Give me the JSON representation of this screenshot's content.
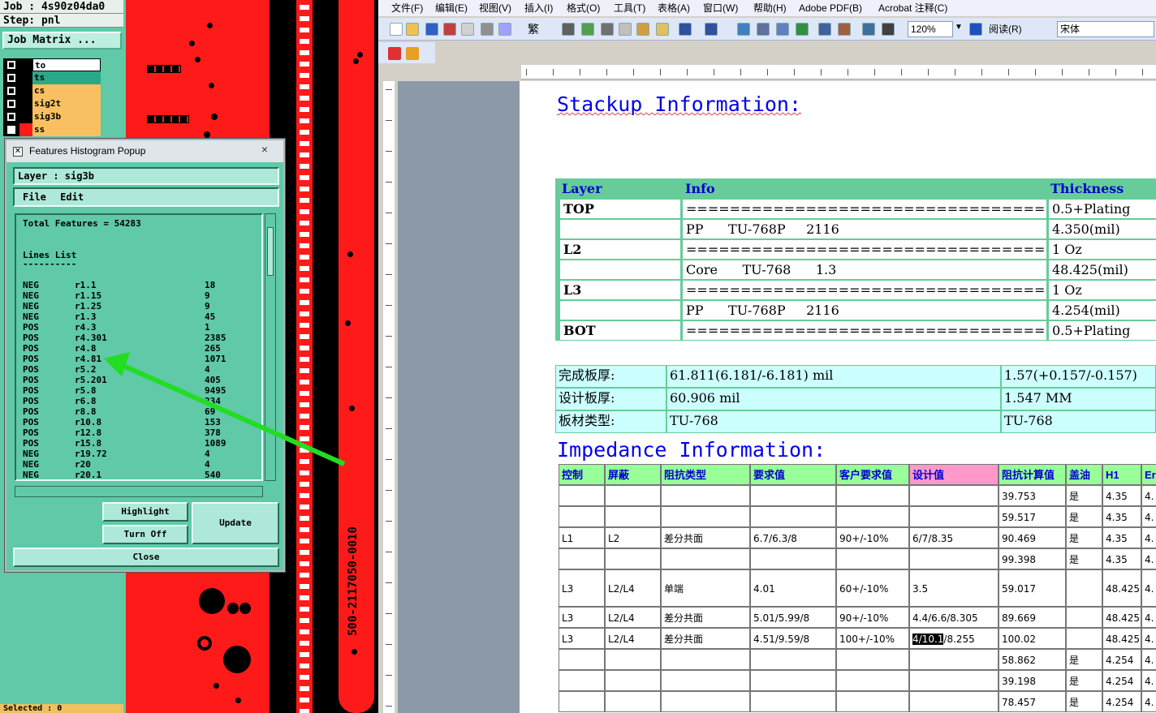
{
  "cam": {
    "job_label": "Job : 4s90z04da0",
    "step_label": "Step: pnl",
    "job_matrix_button": "Job Matrix ...",
    "layers": [
      {
        "name": "to",
        "color": "#ffffff"
      },
      {
        "name": "ts",
        "color": "#2aa88a"
      },
      {
        "name": "cs",
        "color": "#f8c060"
      },
      {
        "name": "sig2t",
        "color": "#f8c060"
      },
      {
        "name": "sig3b",
        "color": "#f8c060"
      },
      {
        "name": "ss",
        "color": "#f8c060"
      }
    ],
    "selected_label": "Selected : 0",
    "board_text": "500-2117050-0010"
  },
  "popup": {
    "title": "Features Histogram Popup",
    "close_glyph": "×",
    "layer_field": "Layer :  sig3b",
    "menu": [
      "File",
      "Edit"
    ],
    "total_features": "Total Features = 54283",
    "list_title": "Lines List",
    "list_rule": "----------",
    "rows": [
      {
        "pol": "NEG",
        "sym": "r1.1",
        "count": "18"
      },
      {
        "pol": "NEG",
        "sym": "r1.15",
        "count": "9"
      },
      {
        "pol": "NEG",
        "sym": "r1.25",
        "count": "9"
      },
      {
        "pol": "NEG",
        "sym": "r1.3",
        "count": "45"
      },
      {
        "pol": "POS",
        "sym": "r4.3",
        "count": "1"
      },
      {
        "pol": "POS",
        "sym": "r4.301",
        "count": "2385"
      },
      {
        "pol": "POS",
        "sym": "r4.8",
        "count": "265"
      },
      {
        "pol": "POS",
        "sym": "r4.81",
        "count": "1071"
      },
      {
        "pol": "POS",
        "sym": "r5.2",
        "count": "4"
      },
      {
        "pol": "POS",
        "sym": "r5.201",
        "count": "405"
      },
      {
        "pol": "POS",
        "sym": "r5.8",
        "count": "9495"
      },
      {
        "pol": "POS",
        "sym": "r6.8",
        "count": "234"
      },
      {
        "pol": "POS",
        "sym": "r8.8",
        "count": "69"
      },
      {
        "pol": "POS",
        "sym": "r10.8",
        "count": "153"
      },
      {
        "pol": "POS",
        "sym": "r12.8",
        "count": "378"
      },
      {
        "pol": "POS",
        "sym": "r15.8",
        "count": "1089"
      },
      {
        "pol": "NEG",
        "sym": "r19.72",
        "count": "4"
      },
      {
        "pol": "NEG",
        "sym": "r20",
        "count": "4"
      },
      {
        "pol": "NEG",
        "sym": "r20.1",
        "count": "540"
      }
    ],
    "buttons": {
      "highlight": "Highlight",
      "turn_off": "Turn Off",
      "update": "Update",
      "close": "Close"
    }
  },
  "word": {
    "menu": [
      "文件(F)",
      "编辑(E)",
      "视图(V)",
      "插入(I)",
      "格式(O)",
      "工具(T)",
      "表格(A)",
      "窗口(W)",
      "帮助(H)",
      "Adobe PDF(B)",
      "Acrobat 注释(C)"
    ],
    "zoom": "120%",
    "read_button": "阅读(R)",
    "font_name": "宋体",
    "traditional": "繁"
  },
  "doc": {
    "stackup_title": "Stackup Information:",
    "stack_headers": [
      "Layer",
      "Info",
      "Thickness"
    ],
    "stack_rows": [
      {
        "layer": "TOP",
        "info": "====================================",
        "thick": "0.5+Plating"
      },
      {
        "layer": "",
        "info": "PP      TU-768P     2116",
        "thick": "4.350(mil)"
      },
      {
        "layer": "L2",
        "info": "====================================",
        "thick": "1 Oz"
      },
      {
        "layer": "",
        "info": "Core      TU-768      1.3",
        "thick": "48.425(mil)"
      },
      {
        "layer": "L3",
        "info": "====================================",
        "thick": "1 Oz"
      },
      {
        "layer": "",
        "info": "PP      TU-768P     2116",
        "thick": "4.254(mil)"
      },
      {
        "layer": "BOT",
        "info": "====================================",
        "thick": "0.5+Plating"
      }
    ],
    "thickness_rows": [
      {
        "label": "完成板厚:",
        "value": "61.811(6.181/-6.181) mil",
        "metric": "1.57(+0.157/-0.157)"
      },
      {
        "label": "设计板厚:",
        "value": "60.906 mil",
        "metric": "1.547 MM"
      },
      {
        "label": "板材类型:",
        "value": "TU-768",
        "metric": "TU-768"
      }
    ],
    "impedance_title": "Impedance Information:",
    "imp_headers": [
      "控制",
      "屏蔽",
      "阻抗类型",
      "要求值",
      "客户要求值",
      "设计值",
      "阻抗计算值",
      "盖油",
      "H1",
      "Er"
    ],
    "imp_rows": [
      [
        "",
        "",
        "",
        "",
        "",
        "",
        "39.753",
        "是",
        "4.35",
        "4."
      ],
      [
        "",
        "",
        "",
        "",
        "",
        "",
        "59.517",
        "是",
        "4.35",
        "4."
      ],
      [
        "L1",
        "L2",
        "差分共面",
        "6.7/6.3/8",
        "90+/-10%",
        "6/7/8.35",
        "90.469",
        "是",
        "4.35",
        "4."
      ],
      [
        "",
        "",
        "",
        "",
        "",
        "",
        "99.398",
        "是",
        "4.35",
        "4."
      ],
      [
        "L3",
        "L2/L4",
        "单端",
        "4.01",
        "60+/-10%",
        "3.5",
        "59.017",
        "",
        "48.425",
        "4."
      ],
      [
        "L3",
        "L2/L4",
        "差分共面",
        "5.01/5.99/8",
        "90+/-10%",
        "4.4/6.6/8.305",
        "89.669",
        "",
        "48.425",
        "4."
      ],
      [
        "L3",
        "L2/L4",
        "差分共面",
        "4.51/9.59/8",
        "100+/-10%",
        "4/10.1/8.255",
        "100.02",
        "",
        "48.425",
        "4."
      ],
      [
        "",
        "",
        "",
        "",
        "",
        "",
        "58.862",
        "是",
        "4.254",
        "4."
      ],
      [
        "",
        "",
        "",
        "",
        "",
        "",
        "39.198",
        "是",
        "4.254",
        "4."
      ],
      [
        "",
        "",
        "",
        "",
        "",
        "",
        "78.457",
        "是",
        "4.254",
        "4."
      ]
    ]
  },
  "colors": {
    "arrow": "#22dd22",
    "pcb_red": "#ff1a1a",
    "cam_teal": "#5fc9a8",
    "header_pink": "#ff99cc"
  }
}
